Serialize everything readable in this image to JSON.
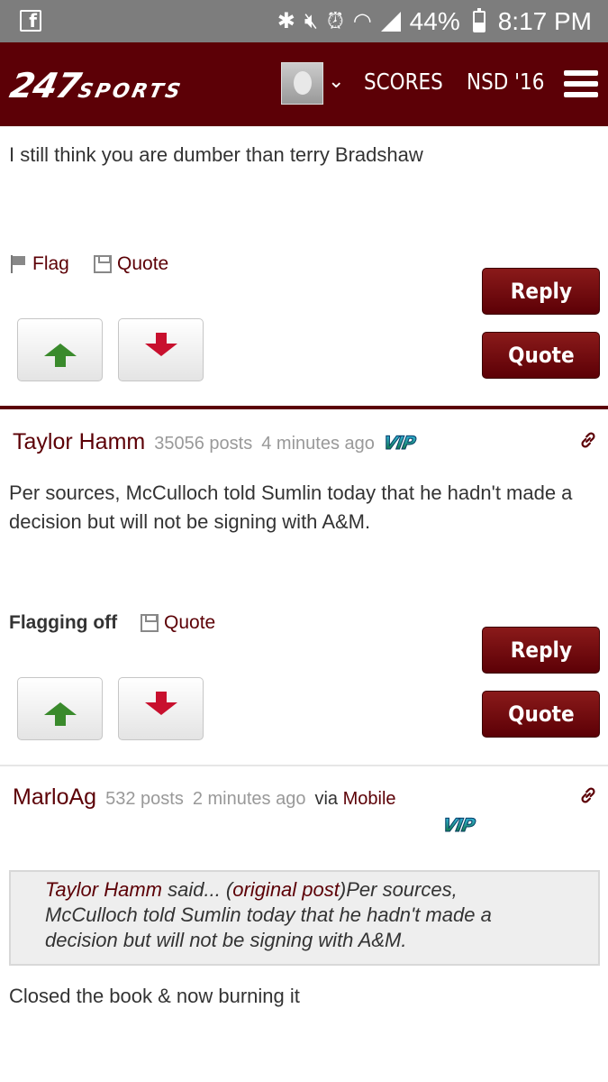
{
  "status_bar": {
    "battery": "44%",
    "time": "8:17 PM",
    "icons": [
      "facebook-icon",
      "bluetooth-icon",
      "mute-icon",
      "alarm-icon",
      "wifi-icon",
      "signal-icon",
      "battery-icon"
    ]
  },
  "nav": {
    "logo_num": "247",
    "logo_text": "SPORTS",
    "links": [
      "SCORES",
      "NSD '16"
    ]
  },
  "colors": {
    "brand": "#5c0006",
    "up": "#3a8a2c",
    "down": "#c8102e"
  },
  "posts": [
    {
      "body": "I still think you are dumber than terry Bradshaw",
      "flag_label": "Flag",
      "quote_label": "Quote",
      "reply_button": "Reply",
      "quote_button": "Quote"
    },
    {
      "author": "Taylor Hamm",
      "post_count": "35056 posts",
      "time": "4 minutes ago",
      "badge": "VIP",
      "body": "Per sources, McCulloch told Sumlin today that he hadn't made a decision but will not be signing with A&M.",
      "flagging": "Flagging off",
      "quote_label": "Quote",
      "reply_button": "Reply",
      "quote_button": "Quote"
    },
    {
      "author": "MarloAg",
      "post_count": "532 posts",
      "time": "2 minutes ago",
      "via": "via",
      "via_link": "Mobile",
      "badge": "VIP",
      "quoted": {
        "author": "Taylor Hamm",
        "said": " said... (",
        "link": "original post",
        "close": ")",
        "text": "Per sources, McCulloch told Sumlin today that he hadn't made a decision but will not be signing with A&M."
      },
      "body": "Closed the book & now burning it"
    }
  ]
}
